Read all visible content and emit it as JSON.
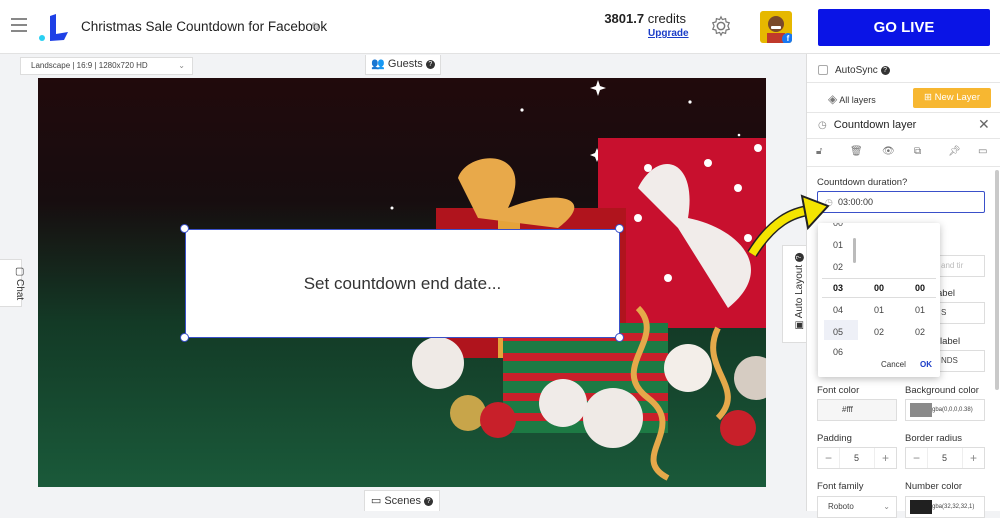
{
  "header": {
    "title": "Christmas Sale Countdown for Facebook",
    "credits_value": "3801.7",
    "credits_unit": "credits",
    "upgrade_label": "Upgrade",
    "go_live_label": "GO LIVE",
    "avatar_badge": "f"
  },
  "toolbar": {
    "resolution": "Landscape | 16:9 | 1280x720 HD",
    "guests_label": "Guests",
    "chat_label": "Chat",
    "scenes_label": "Scenes",
    "auto_layout_label": "Auto Layout"
  },
  "canvas": {
    "countdown_text": "Set countdown end date..."
  },
  "panel": {
    "autosync_label": "AutoSync",
    "all_layers_label": "All layers",
    "new_layer_label": "New Layer",
    "layer_title": "Countdown layer",
    "duration_label": "Countdown duration?",
    "duration_value": "03:00:00",
    "partial_label_1": "abel",
    "partial_label_2": "label",
    "partial_field_1": "and tir",
    "partial_field_2": "S",
    "partial_field_3": "NDS",
    "font_color_label": "Font color",
    "font_color_value": "#fff",
    "bg_color_label": "Background color",
    "bg_color_value": "rgba(0,0,0,0.38)",
    "padding_label": "Padding",
    "padding_value": "5",
    "border_radius_label": "Border radius",
    "border_radius_value": "5",
    "font_family_label": "Font family",
    "font_family_value": "Roboto",
    "number_color_label": "Number color",
    "number_color_value": "rgba(32,32,32,1)"
  },
  "time_picker": {
    "hours": [
      "00",
      "01",
      "02",
      "03",
      "04",
      "05",
      "06"
    ],
    "minutes": [
      "00",
      "01",
      "02"
    ],
    "seconds": [
      "00",
      "01",
      "02"
    ],
    "cancel_label": "Cancel",
    "ok_label": "OK"
  },
  "colors": {
    "accent": "#0a14e6",
    "new_layer": "#f7b731",
    "selection": "#3a50c9"
  }
}
